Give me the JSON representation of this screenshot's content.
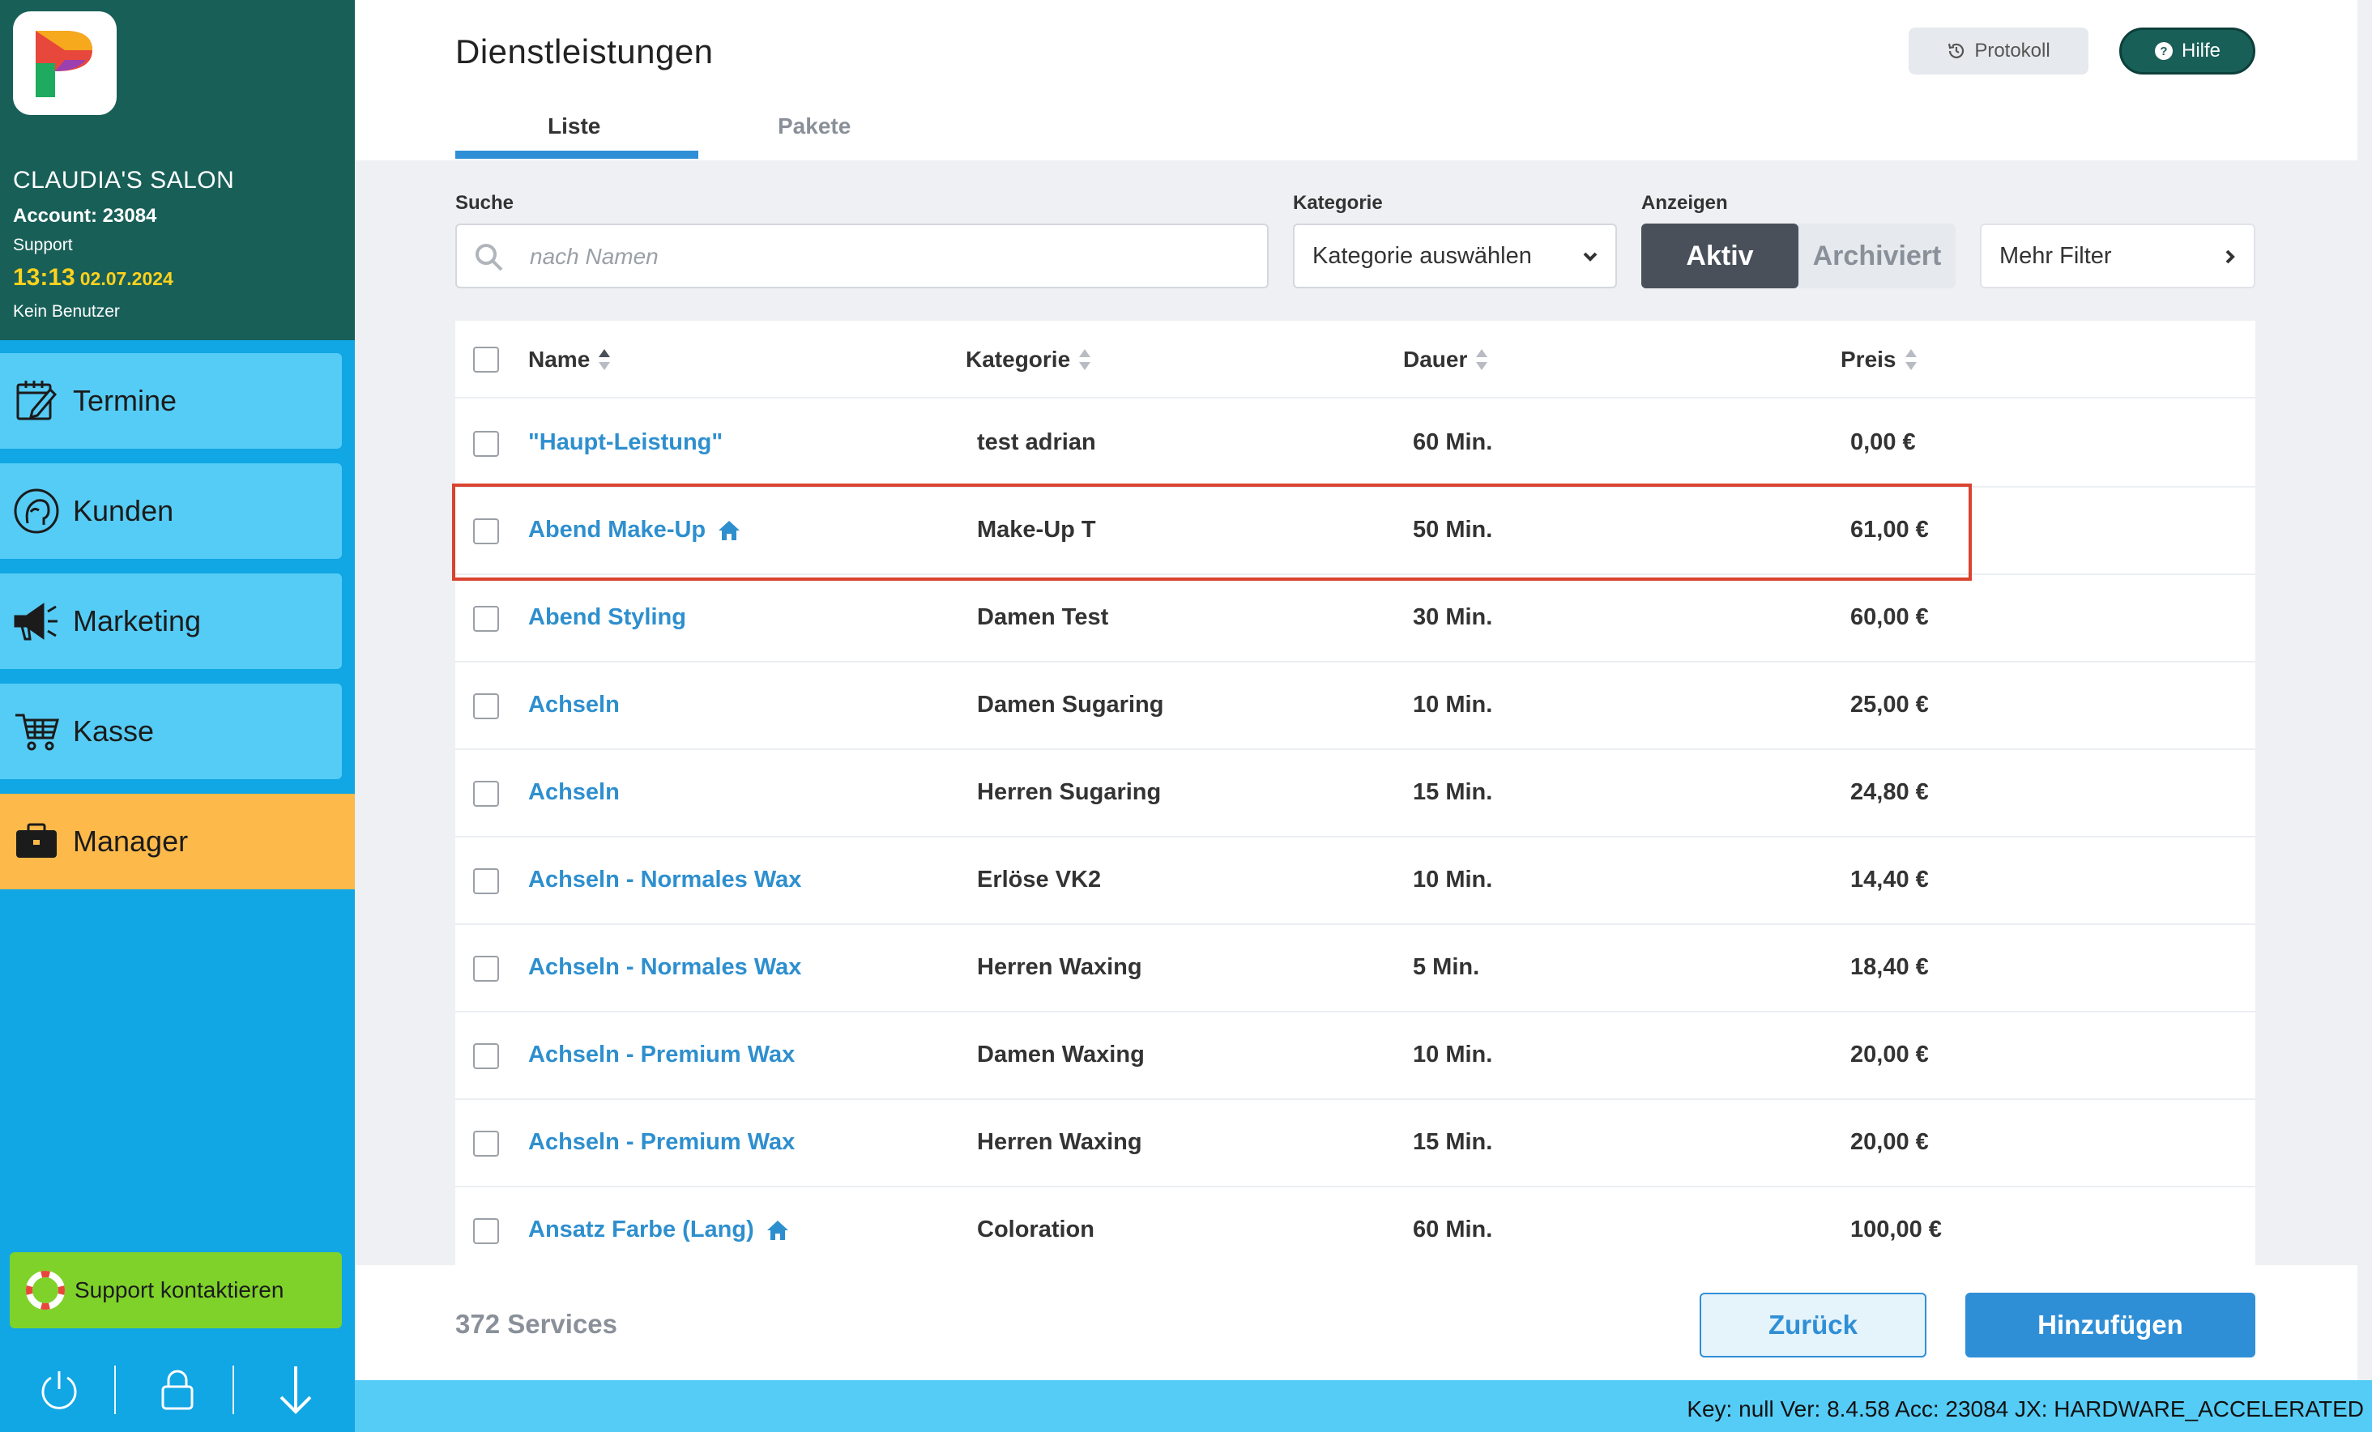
{
  "sidebar": {
    "salon_name": "CLAUDIA'S SALON",
    "account": "Account: 23084",
    "role": "Support",
    "time": "13:13",
    "date": "02.07.2024",
    "user": "Kein Benutzer",
    "nav": [
      {
        "label": "Termine",
        "icon": "calendar-edit-icon"
      },
      {
        "label": "Kunden",
        "icon": "customer-head-icon"
      },
      {
        "label": "Marketing",
        "icon": "megaphone-icon"
      },
      {
        "label": "Kasse",
        "icon": "cart-icon"
      },
      {
        "label": "Manager",
        "icon": "briefcase-icon",
        "active": true
      }
    ],
    "support_label": "Support kontaktieren",
    "accent_colors": {
      "nav": "#55ccf6",
      "active": "#fdb94a",
      "header": "#185f58",
      "support": "#7fd22a"
    }
  },
  "header": {
    "title": "Dienstleistungen",
    "protokoll": "Protokoll",
    "hilfe": "Hilfe",
    "tabs": [
      {
        "label": "Liste",
        "active": true
      },
      {
        "label": "Pakete",
        "active": false
      }
    ]
  },
  "filters": {
    "search_label": "Suche",
    "search_placeholder": "nach Namen",
    "category_label": "Kategorie",
    "category_value": "Kategorie auswählen",
    "show_label": "Anzeigen",
    "show_active": "Aktiv",
    "show_archived": "Archiviert",
    "more_filter": "Mehr Filter"
  },
  "table": {
    "columns": {
      "name": "Name",
      "category": "Kategorie",
      "duration": "Dauer",
      "price": "Preis"
    },
    "rows": [
      {
        "name": "\"Haupt-Leistung\"",
        "home": false,
        "category": "test adrian",
        "duration": "60 Min.",
        "price": "0,00 €"
      },
      {
        "name": "Abend Make-Up",
        "home": true,
        "category": "Make-Up T",
        "duration": "50 Min.",
        "price": "61,00 €"
      },
      {
        "name": "Abend Styling",
        "home": false,
        "category": "Damen Test",
        "duration": "30 Min.",
        "price": "60,00 €"
      },
      {
        "name": "Achseln",
        "home": false,
        "category": "Damen Sugaring",
        "duration": "10 Min.",
        "price": "25,00 €"
      },
      {
        "name": "Achseln",
        "home": false,
        "category": "Herren Sugaring",
        "duration": "15 Min.",
        "price": "24,80 €"
      },
      {
        "name": "Achseln - Normales Wax",
        "home": false,
        "category": "Erlöse VK2",
        "duration": "10 Min.",
        "price": "14,40 €"
      },
      {
        "name": "Achseln - Normales Wax",
        "home": false,
        "category": "Herren Waxing",
        "duration": "5 Min.",
        "price": "18,40 €"
      },
      {
        "name": "Achseln - Premium Wax",
        "home": false,
        "category": "Damen Waxing",
        "duration": "10 Min.",
        "price": "20,00 €"
      },
      {
        "name": "Achseln - Premium Wax",
        "home": false,
        "category": "Herren Waxing",
        "duration": "15 Min.",
        "price": "20,00 €"
      },
      {
        "name": "Ansatz Farbe (Lang)",
        "home": true,
        "category": "Coloration",
        "duration": "60 Min.",
        "price": "100,00 €"
      }
    ]
  },
  "footer": {
    "count": "372 Services",
    "back": "Zurück",
    "add": "Hinzufügen"
  },
  "statusbar": {
    "text": "Key: null Ver: 8.4.58 Acc: 23084  JX: HARDWARE_ACCELERATED"
  }
}
